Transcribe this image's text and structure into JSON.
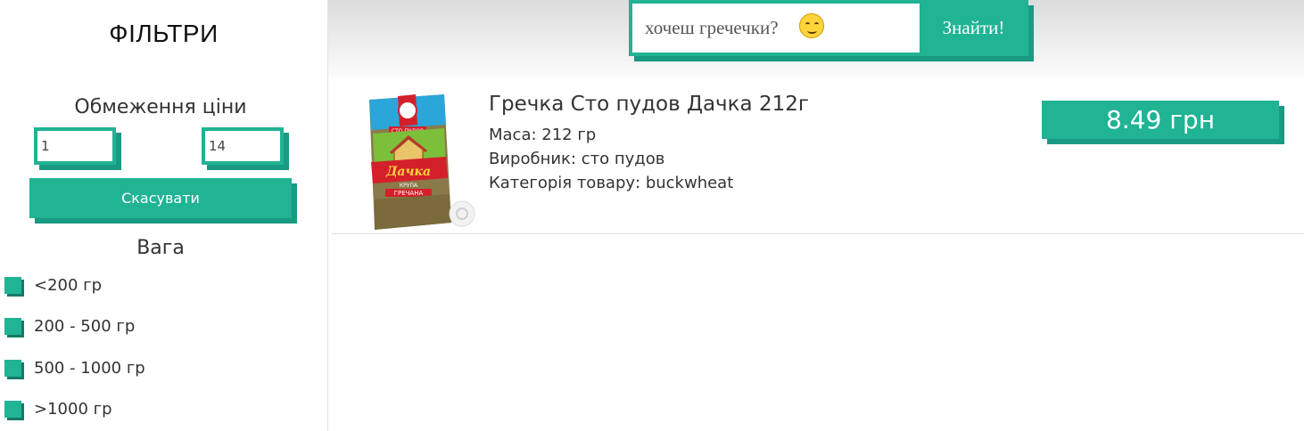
{
  "sidebar": {
    "title": "ФІЛЬТРИ",
    "price_filter": {
      "title": "Обмеження ціни",
      "min_value": "1",
      "max_value": "14",
      "cancel_label": "Скасувати"
    },
    "weight_filter": {
      "title": "Вага",
      "options": [
        "<200 гр",
        "200 - 500 гр",
        "500 - 1000 гр",
        ">1000 гр"
      ]
    }
  },
  "search": {
    "value": "хочеш гречечки?",
    "emoji": "smirk-face-icon",
    "button_label": "Знайти!"
  },
  "products": [
    {
      "name": "Гречка Сто пудов Дачка 212г",
      "mass": "Маса: 212 гр",
      "manufacturer": "Виробник: сто пудов",
      "category": "Категорія товару: buckwheat",
      "price": "8.49 грн",
      "package_text": {
        "brand": "СТО ПУДОВ",
        "title": "Дачка",
        "subtitle_1": "КРУПА",
        "subtitle_2": "ГРЕЧАНА"
      }
    }
  ],
  "colors": {
    "accent": "#20b394",
    "accent_shadow": "#1a9a82"
  }
}
